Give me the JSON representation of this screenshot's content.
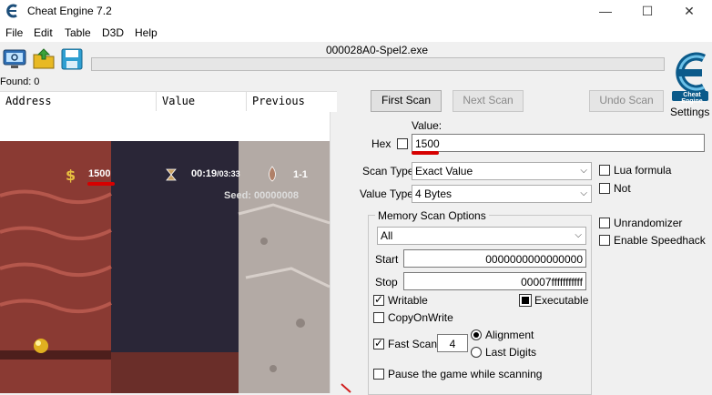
{
  "window": {
    "title": "Cheat Engine 7.2",
    "controls": {
      "minimize": "—",
      "maximize": "☐",
      "close": "✕"
    }
  },
  "menu": [
    "File",
    "Edit",
    "Table",
    "D3D",
    "Help"
  ],
  "toolbar": {
    "process_name": "000028A0-Spel2.exe",
    "settings_label": "Settings",
    "logo_text": "Cheat Engine"
  },
  "found_label": "Found: 0",
  "list": {
    "columns": [
      "Address",
      "Value",
      "Previous"
    ]
  },
  "game": {
    "money": "1500",
    "time": "00:19",
    "time_total": "/03:33",
    "level": "1-1",
    "seed": "Seed: 00000008"
  },
  "scan": {
    "first_scan": "First Scan",
    "next_scan": "Next Scan",
    "undo_scan": "Undo Scan",
    "value_label": "Value:",
    "hex_label": "Hex",
    "value": "1500",
    "scan_type_label": "Scan Type",
    "scan_type_value": "Exact Value",
    "value_type_label": "Value Type",
    "value_type_value": "4 Bytes",
    "lua_formula": "Lua formula",
    "not_label": "Not",
    "unrandomizer": "Unrandomizer",
    "enable_speedhack": "Enable Speedhack"
  },
  "memory_scan": {
    "title": "Memory Scan Options",
    "region": "All",
    "start_label": "Start",
    "start_value": "0000000000000000",
    "stop_label": "Stop",
    "stop_value": "00007fffffffffff",
    "writable": "Writable",
    "executable": "Executable",
    "copy_on_write": "CopyOnWrite",
    "fast_scan": "Fast Scan",
    "fast_scan_value": "4",
    "alignment": "Alignment",
    "last_digits": "Last Digits",
    "pause_game": "Pause the game while scanning"
  },
  "colors": {
    "underline": "#d60000",
    "game_dirt": "#8a3a33",
    "game_dark": "#2a2333",
    "game_stone": "#b3aaa5"
  }
}
